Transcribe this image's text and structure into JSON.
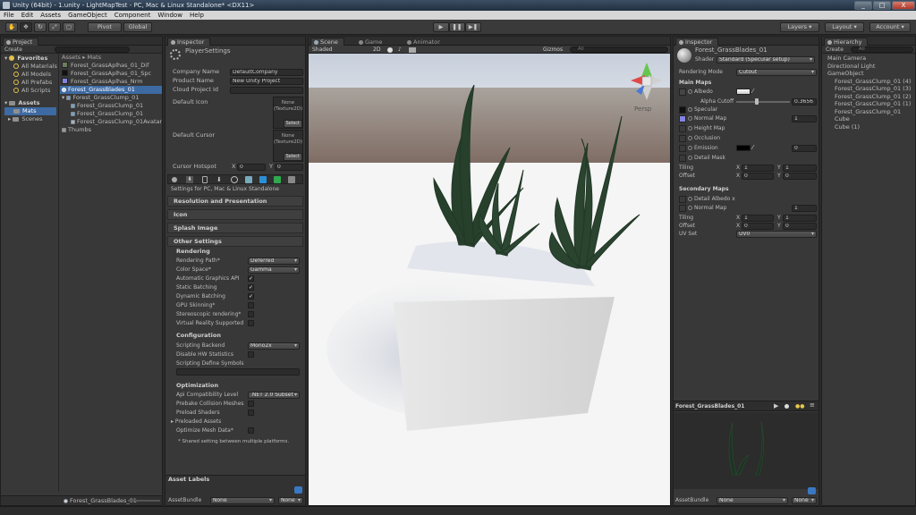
{
  "window": {
    "title": "Unity (64bit) - 1.unity - LightMapTest - PC, Mac & Linux Standalone* <DX11>",
    "minimize": "_",
    "maximize": "□",
    "close": "X"
  },
  "menu": [
    "File",
    "Edit",
    "Assets",
    "GameObject",
    "Component",
    "Window",
    "Help"
  ],
  "toolbar": {
    "pivot": "Pivot",
    "global": "Global",
    "layers": "Layers",
    "layout": "Layout",
    "account": "Account"
  },
  "project": {
    "tab": "Project",
    "create": "Create",
    "favorites_label": "Favorites",
    "favorites": [
      "All Materials",
      "All Models",
      "All Prefabs",
      "All Scripts"
    ],
    "assets_label": "Assets",
    "asset_folders": [
      "Mats",
      "Scenes"
    ],
    "breadcrumb": "Assets ▸ Mats",
    "files": [
      "Forest_GrassAplhas_01_Dif",
      "Forest_GrassAplhas_01_Spc",
      "Forest_GrassAplhas_Nrm",
      "Forest_GrassBlades_01",
      "Forest_GrassClump_01",
      "Forest_GrassClump_01",
      "Forest_GrassClump_01",
      "Forest_GrassClump_01Avatar",
      "Thumbs"
    ],
    "footer": "Forest_GrassBlades_01"
  },
  "player_inspector": {
    "tab": "Inspector",
    "title": "PlayerSettings",
    "company_label": "Company Name",
    "company": "DefaultCompany",
    "product_label": "Product Name",
    "product": "New Unity Project",
    "cloud_label": "Cloud Project Id",
    "cloud": "",
    "icon_label": "Default Icon",
    "cursor_label": "Default Cursor",
    "tex_none": "None",
    "tex_type": "(Texture2D)",
    "select": "Select",
    "hotspot_label": "Cursor Hotspot",
    "hotspot_x_label": "X",
    "hotspot_x": "0",
    "hotspot_y_label": "Y",
    "hotspot_y": "0",
    "settings_for": "Settings for PC, Mac & Linux Standalone",
    "sections": [
      "Resolution and Presentation",
      "Icon",
      "Splash Image",
      "Other Settings"
    ],
    "rendering_title": "Rendering",
    "rendering_path_label": "Rendering Path*",
    "rendering_path": "Deferred",
    "color_space_label": "Color Space*",
    "color_space": "Gamma",
    "checks": [
      {
        "label": "Automatic Graphics API",
        "checked": "✓"
      },
      {
        "label": "Static Batching",
        "checked": "✓"
      },
      {
        "label": "Dynamic Batching",
        "checked": "✓"
      },
      {
        "label": "GPU Skinning*",
        "checked": ""
      },
      {
        "label": "Stereoscopic rendering*",
        "checked": ""
      },
      {
        "label": "Virtual Reality Supported",
        "checked": ""
      }
    ],
    "config_title": "Configuration",
    "backend_label": "Scripting Backend",
    "backend": "Mono2x",
    "hw_stats_label": "Disable HW Statistics",
    "define_label": "Scripting Define Symbols",
    "opt_title": "Optimization",
    "api_label": "Api Compatibility Level",
    "api": ".NET 2.0 Subset",
    "opt_checks": [
      "Prebake Collision Meshes",
      "Preload Shaders"
    ],
    "preloaded_label": "Preloaded Assets",
    "mesh_data_label": "Optimize Mesh Data*",
    "shared_note": "* Shared setting between multiple platforms.",
    "asset_labels": "Asset Labels",
    "assetbundle_label": "AssetBundle",
    "assetbundle": "None",
    "variant": "None"
  },
  "scene": {
    "tabs": [
      "Scene",
      "Game",
      "Animator"
    ],
    "shaded": "Shaded",
    "mode_2d": "2D",
    "gizmos": "Gizmos",
    "search": "All",
    "persp": "Persp"
  },
  "mat_inspector": {
    "tab": "Inspector",
    "title": "Forest_GrassBlades_01",
    "shader_label": "Shader",
    "shader": "Standard (Specular setup)",
    "rendering_mode_label": "Rendering Mode",
    "rendering_mode": "Cutout",
    "main_maps": "Main Maps",
    "albedo": "Albedo",
    "alpha_cutoff_label": "Alpha Cutoff",
    "alpha_cutoff": "0.3656",
    "specular": "Specular",
    "normal_map": "Normal Map",
    "normal_val": "1",
    "height_map": "Height Map",
    "occlusion": "Occlusion",
    "emission": "Emission",
    "emission_val": "0",
    "detail_mask": "Detail Mask",
    "tiling_label": "Tiling",
    "offset_label": "Offset",
    "x_label": "X",
    "y_label": "Y",
    "tiling_x": "1",
    "tiling_y": "1",
    "offset_x": "0",
    "offset_y": "0",
    "secondary_maps": "Secondary Maps",
    "detail_albedo": "Detail Albedo x",
    "detail_normal": "Normal Map",
    "detail_normal_val": "1",
    "sec_tiling_x": "1",
    "sec_tiling_y": "1",
    "sec_offset_x": "0",
    "sec_offset_y": "0",
    "uv_set_label": "UV Set",
    "uv_set": "UV0",
    "preview_title": "Forest_GrassBlades_01",
    "assetbundle_label": "AssetBundle",
    "assetbundle": "None",
    "variant": "None"
  },
  "hierarchy": {
    "tab": "Hierarchy",
    "create": "Create",
    "search": "All",
    "items": [
      {
        "label": "Main Camera",
        "indent": 0
      },
      {
        "label": "Directional Light",
        "indent": 0
      },
      {
        "label": "GameObject",
        "indent": 0
      },
      {
        "label": "Forest_GrassClump_01 (4)",
        "indent": 1
      },
      {
        "label": "Forest_GrassClump_01 (3)",
        "indent": 1
      },
      {
        "label": "Forest_GrassClump_01 (2)",
        "indent": 1
      },
      {
        "label": "Forest_GrassClump_01 (1)",
        "indent": 1
      },
      {
        "label": "Forest_GrassClump_01",
        "indent": 1
      },
      {
        "label": "Cube",
        "indent": 1
      },
      {
        "label": "Cube (1)",
        "indent": 1
      }
    ]
  }
}
